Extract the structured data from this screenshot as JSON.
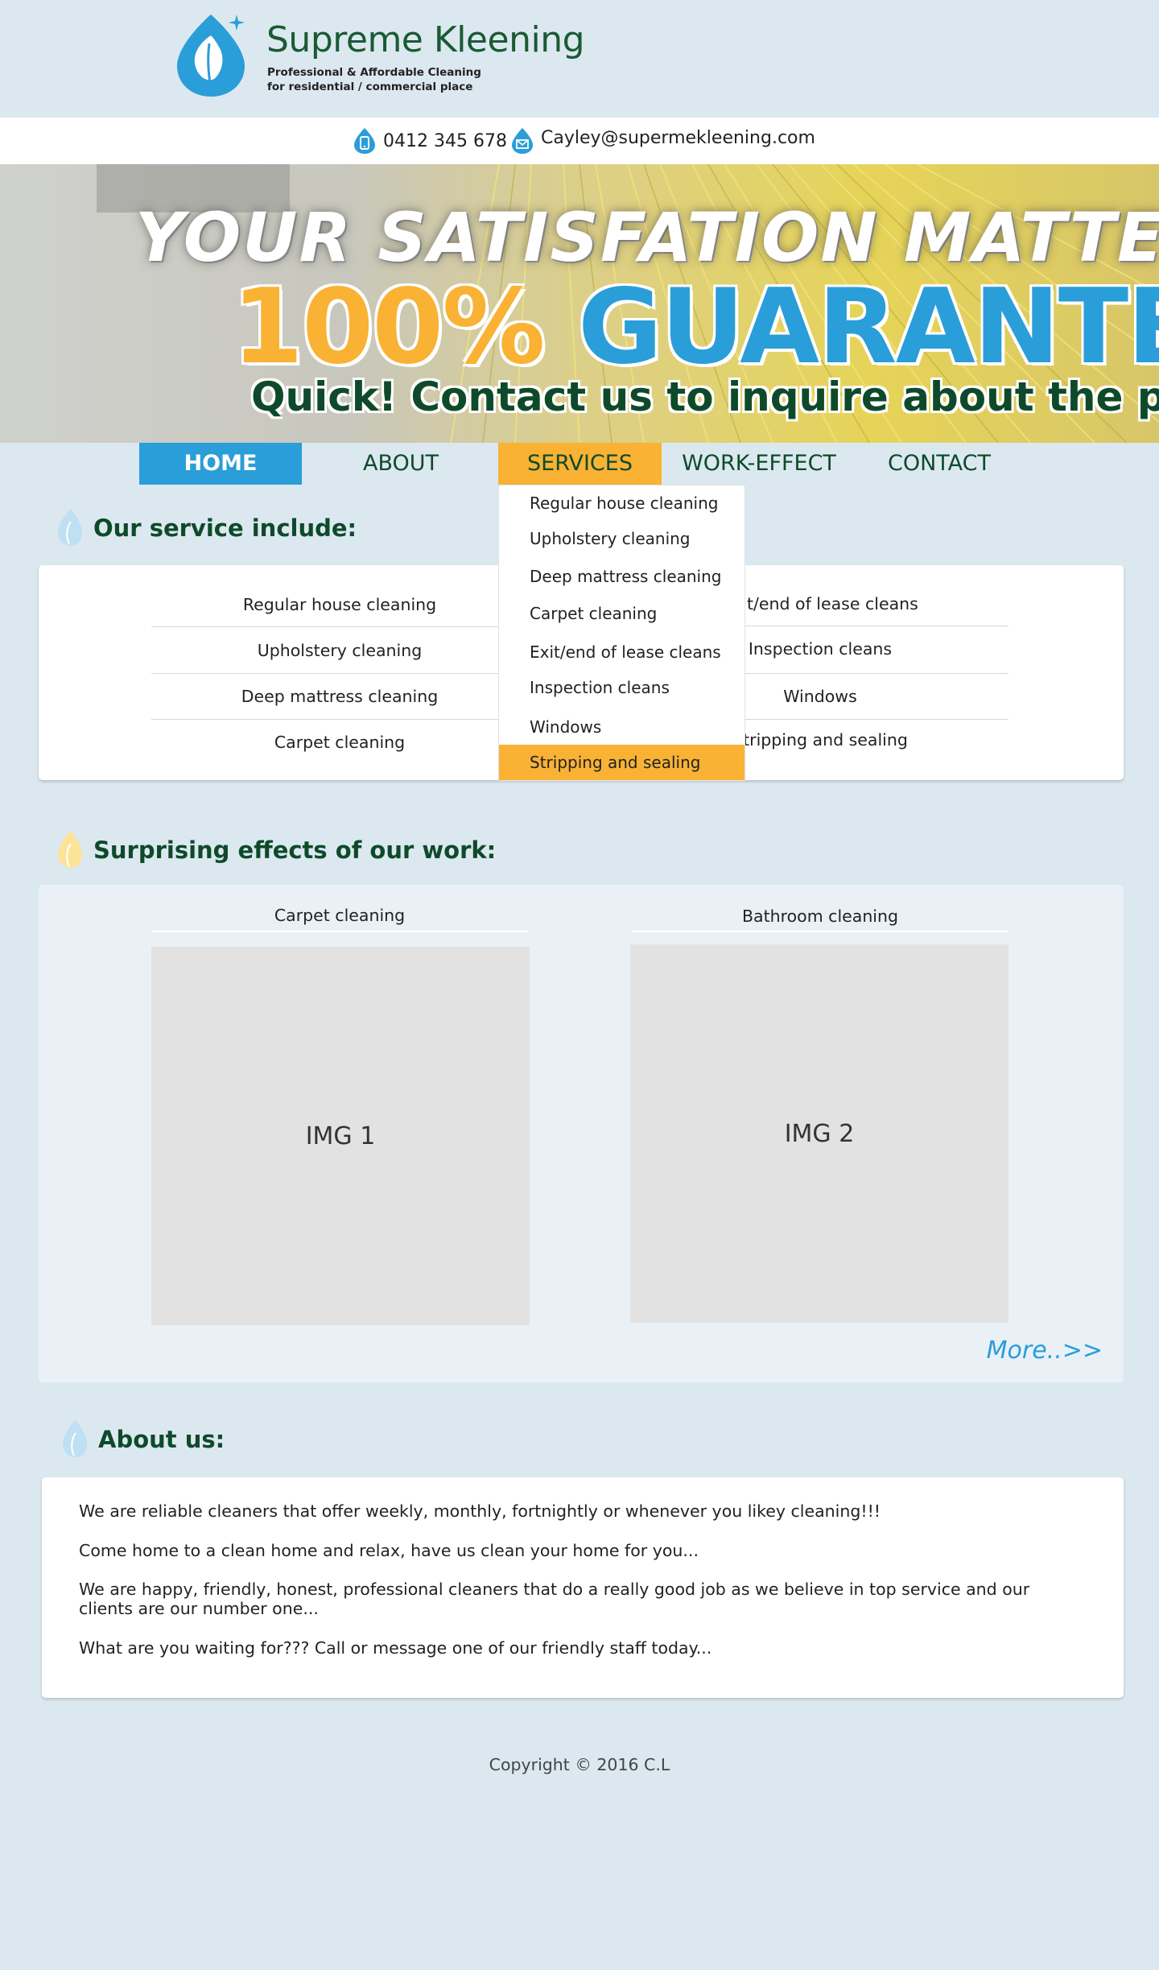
{
  "brand": {
    "name": "Supreme Kleening",
    "tagline_line1": "Professional & Affordable Cleaning",
    "tagline_line2": "for residential / commercial place"
  },
  "contact": {
    "phone": "0412 345 678",
    "email": "Cayley@supermekleening.com"
  },
  "hero": {
    "line1": "YOUR SATISFATION MATTERS",
    "line2_percent": "100%",
    "line2_word": "GUARANTEED",
    "line3": "Quick! Contact us to inquire about the price!"
  },
  "nav": {
    "items": [
      {
        "label": "HOME"
      },
      {
        "label": "ABOUT"
      },
      {
        "label": "SERVICES"
      },
      {
        "label": "WORK-EFFECT"
      },
      {
        "label": "CONTACT"
      }
    ],
    "active": "HOME",
    "hovered": "SERVICES"
  },
  "dropdown": {
    "items": [
      "Regular house cleaning",
      "Upholstery cleaning",
      "Deep mattress cleaning",
      "Carpet cleaning",
      "Exit/end of lease cleans",
      "Inspection cleans",
      "Windows",
      "Stripping and sealing"
    ],
    "highlighted": "Stripping and sealing"
  },
  "services": {
    "title": "Our service include:",
    "left": [
      "Regular house cleaning",
      "Upholstery cleaning",
      "Deep mattress cleaning",
      "Carpet cleaning"
    ],
    "right": [
      "Exit/end of lease cleans",
      "Inspection cleans",
      "Windows",
      "Stripping and sealing"
    ]
  },
  "effects": {
    "title": "Surprising effects of our work:",
    "items": [
      {
        "label": "Carpet cleaning",
        "image": "IMG 1"
      },
      {
        "label": "Bathroom cleaning",
        "image": "IMG 2"
      }
    ],
    "more": "More..>>"
  },
  "about": {
    "title": "About us:",
    "paragraphs": [
      "We are reliable cleaners that offer weekly, monthly, fortnightly or whenever you likey cleaning!!!",
      "Come home to a clean home and relax, have us clean your home for you...",
      "We are happy, friendly, honest, professional cleaners that do a really good job as we believe in top service and our clients are our number one...",
      "What are you waiting for??? Call or message one of our friendly staff today..."
    ]
  },
  "footer": {
    "copyright": "Copyright © 2016 C.L"
  },
  "colors": {
    "brand_green": "#0e4a2a",
    "accent_blue": "#2a9ed8",
    "accent_orange": "#f9b233",
    "page_bg": "#dce8f0"
  }
}
